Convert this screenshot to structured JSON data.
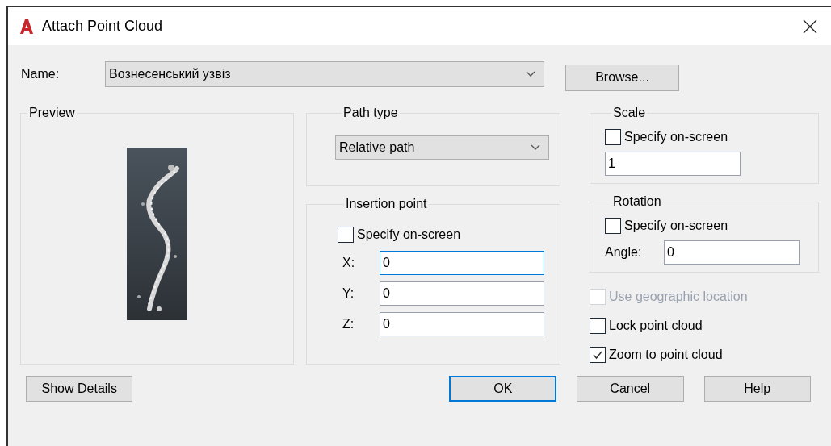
{
  "window": {
    "title": "Attach Point Cloud"
  },
  "name_row": {
    "label": "Name:",
    "value": "Вознесенський узвіз",
    "browse": "Browse..."
  },
  "preview": {
    "legend": "Preview",
    "kind": "picture"
  },
  "path_type": {
    "legend": "Path type",
    "value": "Relative path"
  },
  "insertion_point": {
    "legend": "Insertion point",
    "specify": {
      "label": "Specify on-screen",
      "checked": false
    },
    "fields": [
      {
        "label": "X:",
        "value": "0",
        "focused": true
      },
      {
        "label": "Y:",
        "value": "0",
        "focused": false
      },
      {
        "label": "Z:",
        "value": "0",
        "focused": false
      }
    ]
  },
  "scale": {
    "legend": "Scale",
    "specify": {
      "label": "Specify on-screen",
      "checked": false
    },
    "value": "1"
  },
  "rotation": {
    "legend": "Rotation",
    "specify": {
      "label": "Specify on-screen",
      "checked": false
    },
    "angle_label": "Angle:",
    "angle": "0"
  },
  "options": [
    {
      "label": "Use geographic location",
      "checked": false,
      "disabled": true
    },
    {
      "label": "Lock point cloud",
      "checked": false,
      "disabled": false
    },
    {
      "label": "Zoom to point cloud",
      "checked": true,
      "disabled": false
    }
  ],
  "buttons": [
    {
      "label": "Show Details",
      "default": false
    },
    {
      "label": "OK",
      "default": true
    },
    {
      "label": "Cancel",
      "default": false
    },
    {
      "label": "Help",
      "default": false
    }
  ]
}
